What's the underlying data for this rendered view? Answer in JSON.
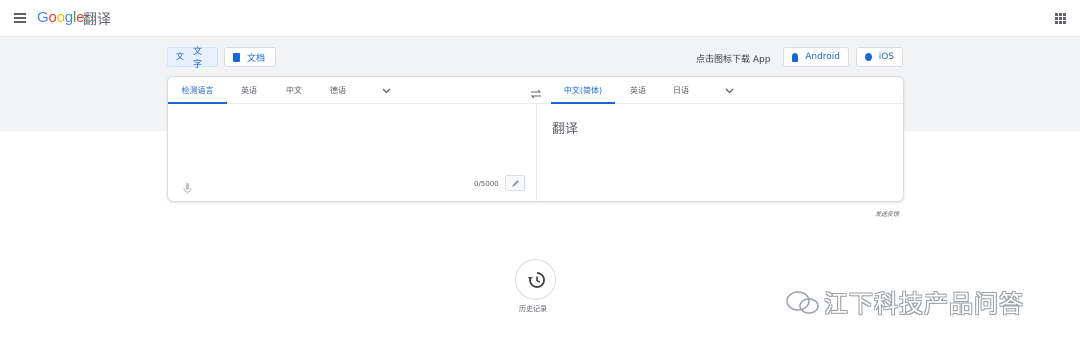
{
  "header": {
    "logo_letters": [
      "G",
      "o",
      "o",
      "g",
      "l",
      "e"
    ],
    "title": "翻译",
    "menu_icon": "hamburger-menu-icon",
    "apps_icon": "apps-grid-icon"
  },
  "modes": {
    "text_label": "文字",
    "doc_label": "文档"
  },
  "download": {
    "label": "点击图标下载 App",
    "android_label": "Android",
    "ios_label": "iOS"
  },
  "source": {
    "tabs": [
      "检测语言",
      "英语",
      "中文",
      "德语"
    ],
    "active_tab": 0,
    "char_count": "0/5000"
  },
  "target": {
    "tabs": [
      "中文(简体)",
      "英语",
      "日语"
    ],
    "active_tab": 0,
    "text": "翻译"
  },
  "feedback_label": "发送反馈",
  "history_label": "历史记录",
  "watermark": "江下科技产品问答",
  "colors": {
    "accent": "#1967d2",
    "band": "#f1f3f4",
    "text_secondary": "#5f6368"
  }
}
